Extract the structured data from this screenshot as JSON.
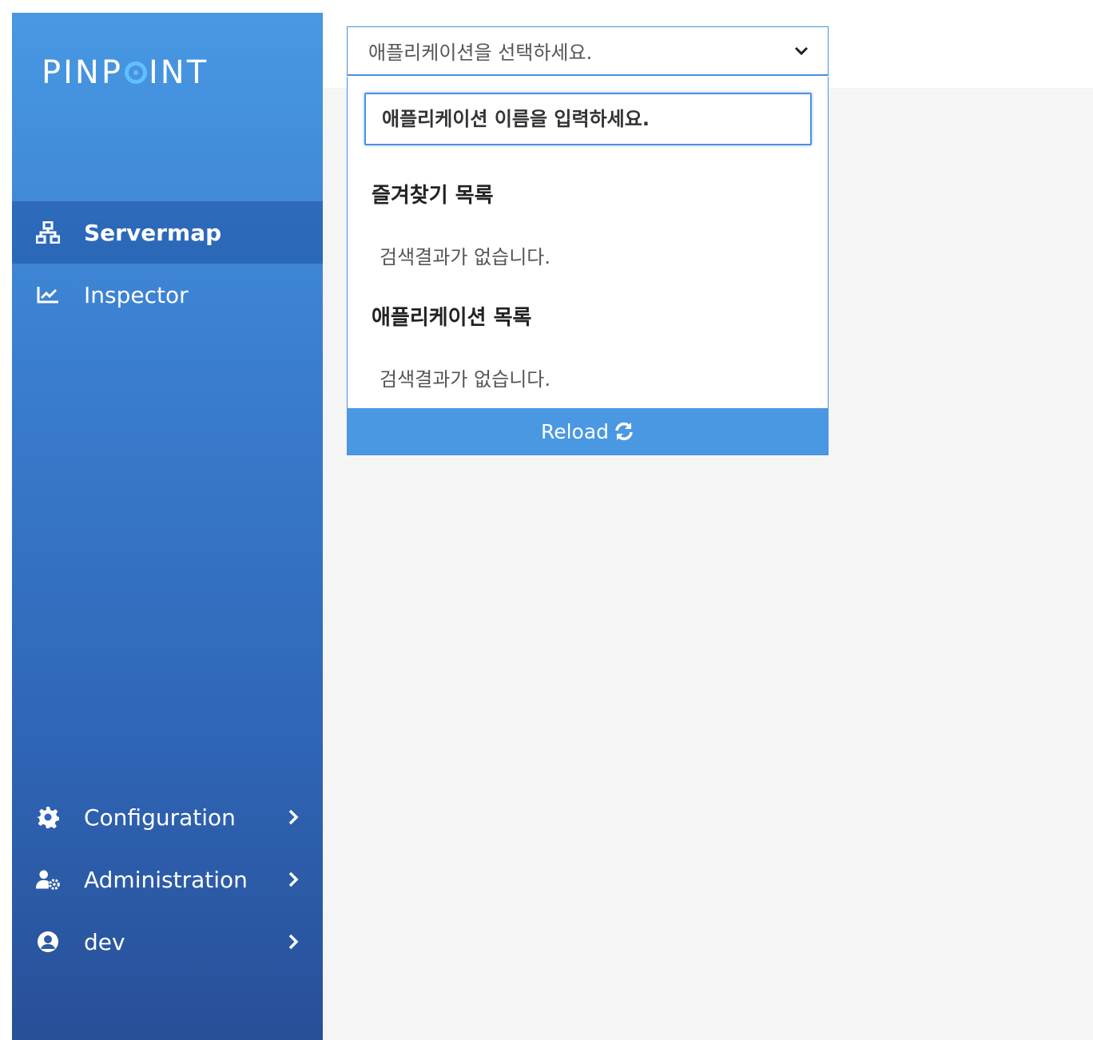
{
  "sidebar": {
    "logo": {
      "left": "PINP",
      "right": "INT"
    },
    "items": [
      {
        "label": "Servermap",
        "icon": "sitemap-icon",
        "active": true
      },
      {
        "label": "Inspector",
        "icon": "chart-line-icon",
        "active": false
      }
    ],
    "bottom_items": [
      {
        "label": "Configuration",
        "icon": "gear-icon"
      },
      {
        "label": "Administration",
        "icon": "user-gear-icon"
      },
      {
        "label": "dev",
        "icon": "user-circle-icon"
      }
    ]
  },
  "app_select": {
    "placeholder": "애플리케이션을 선택하세요.",
    "search_placeholder": "애플리케이션 이름을 입력하세요.",
    "favorites_title": "즐겨찾기 목록",
    "favorites_empty": "검색결과가 없습니다.",
    "apps_title": "애플리케이션 목록",
    "apps_empty": "검색결과가 없습니다.",
    "reload_label": "Reload"
  },
  "colors": {
    "accent": "#4a98e2",
    "sidebar_top": "#4898e2",
    "sidebar_bottom": "#284f98",
    "logo_ring": "#5fc0ff"
  }
}
